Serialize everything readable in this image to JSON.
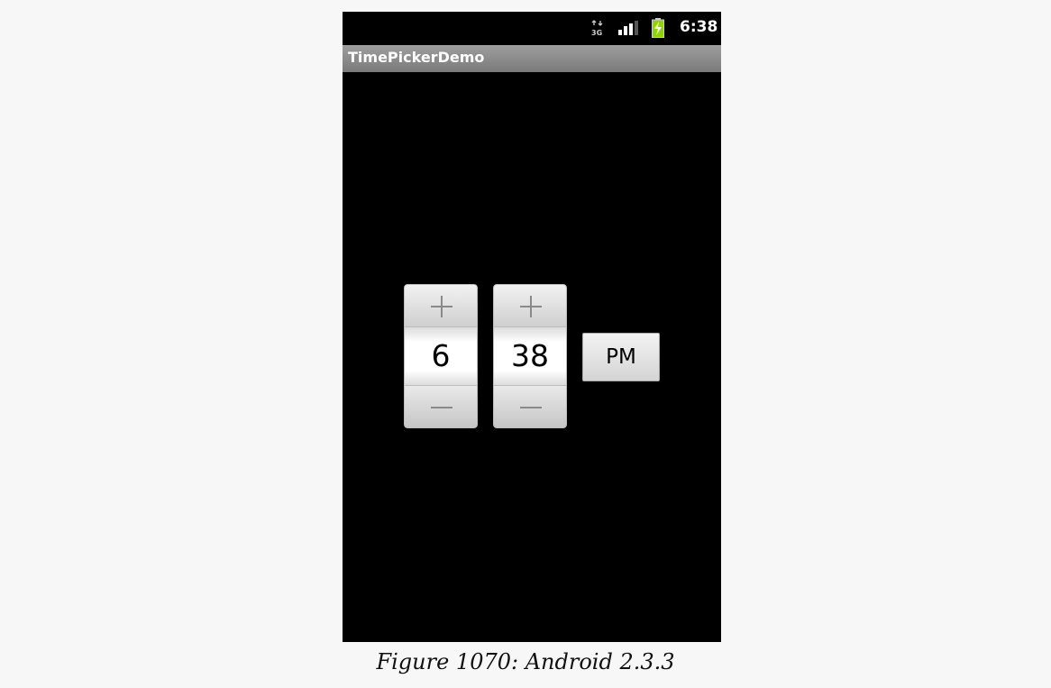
{
  "status_bar": {
    "network_icon": "3g-data-icon",
    "signal_icon": "signal-strength-icon",
    "battery_icon": "battery-charging-icon",
    "time": "6:38"
  },
  "app": {
    "title": "TimePickerDemo"
  },
  "time_picker": {
    "hour": "6",
    "minute": "38",
    "ampm_label": "PM",
    "increment_icon": "plus-icon",
    "decrement_icon": "minus-icon"
  },
  "caption": "Figure 1070: Android 2.3.3",
  "colors": {
    "screen_bg": "#000000",
    "title_bar": "#8c8c8c",
    "page_bg": "#f7f7f7",
    "battery_green": "#8fd400"
  }
}
